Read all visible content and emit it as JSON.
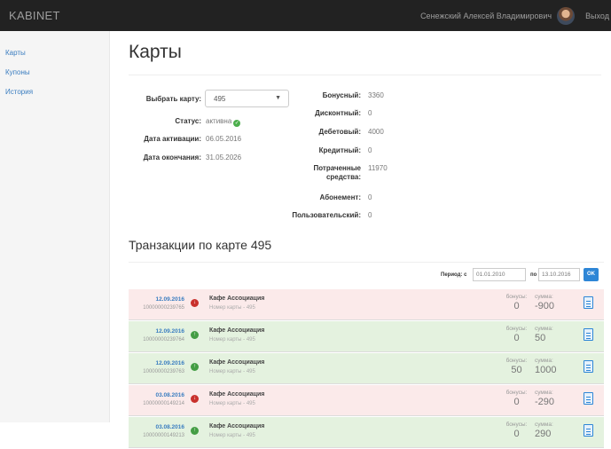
{
  "header": {
    "brand": "KABINET",
    "user_name": "Сенежский Алексей Владимирович",
    "logout": "Выход"
  },
  "sidebar": {
    "items": [
      {
        "label": "Карты"
      },
      {
        "label": "Купоны"
      },
      {
        "label": "История"
      }
    ]
  },
  "page": {
    "title": "Карты"
  },
  "card_info": {
    "select_label": "Выбрать карту:",
    "selected_card": "495",
    "status_label": "Статус:",
    "status_value": "активна",
    "activation_label": "Дата активации:",
    "activation_value": "06.05.2016",
    "expiry_label": "Дата окончания:",
    "expiry_value": "31.05.2026"
  },
  "balances": [
    {
      "label": "Бонусный:",
      "value": "3360"
    },
    {
      "label": "Дисконтный:",
      "value": "0"
    },
    {
      "label": "Дебетовый:",
      "value": "4000"
    },
    {
      "label": "Кредитный:",
      "value": "0"
    },
    {
      "label": "Потраченные средства:",
      "value": "11970"
    },
    {
      "label": "Абонемент:",
      "value": "0"
    },
    {
      "label": "Пользовательский:",
      "value": "0"
    }
  ],
  "transactions": {
    "title": "Транзакции по карте 495",
    "filter": {
      "period_label": "Период: с",
      "from_value": "01.01.2010",
      "to_label": "по",
      "to_value": "13.10.2016",
      "ok_label": "OK"
    },
    "bonus_label": "бонусы:",
    "sum_label": "сумма:",
    "rows": [
      {
        "date": "12.09.2016",
        "number": "10000000239765",
        "type": "neg",
        "place": "Кафе Ассоциация",
        "card": "Номер карты - 495",
        "bonus": "0",
        "sum": "-900"
      },
      {
        "date": "12.09.2016",
        "number": "10000000239764",
        "type": "pos",
        "place": "Кафе Ассоциация",
        "card": "Номер карты - 495",
        "bonus": "0",
        "sum": "50"
      },
      {
        "date": "12.09.2016",
        "number": "10000000239763",
        "type": "pos",
        "place": "Кафе Ассоциация",
        "card": "Номер карты - 495",
        "bonus": "50",
        "sum": "1000"
      },
      {
        "date": "03.08.2016",
        "number": "10000000149214",
        "type": "neg",
        "place": "Кафе Ассоциация",
        "card": "Номер карты - 495",
        "bonus": "0",
        "sum": "-290"
      },
      {
        "date": "03.08.2016",
        "number": "10000000149213",
        "type": "pos",
        "place": "Кафе Ассоциация",
        "card": "Номер карты - 495",
        "bonus": "0",
        "sum": "290"
      }
    ]
  },
  "icons": {
    "status": "check-circle-icon",
    "expense": "arrow-down-circle-icon",
    "income": "arrow-up-circle-icon",
    "details": "document-list-icon",
    "select": "caret-down-icon"
  },
  "colors": {
    "topbar": "#222222",
    "link": "#3a7dc0",
    "expense_row": "#fbeaea",
    "income_row": "#e4f2df",
    "accent": "#2e86d6"
  }
}
